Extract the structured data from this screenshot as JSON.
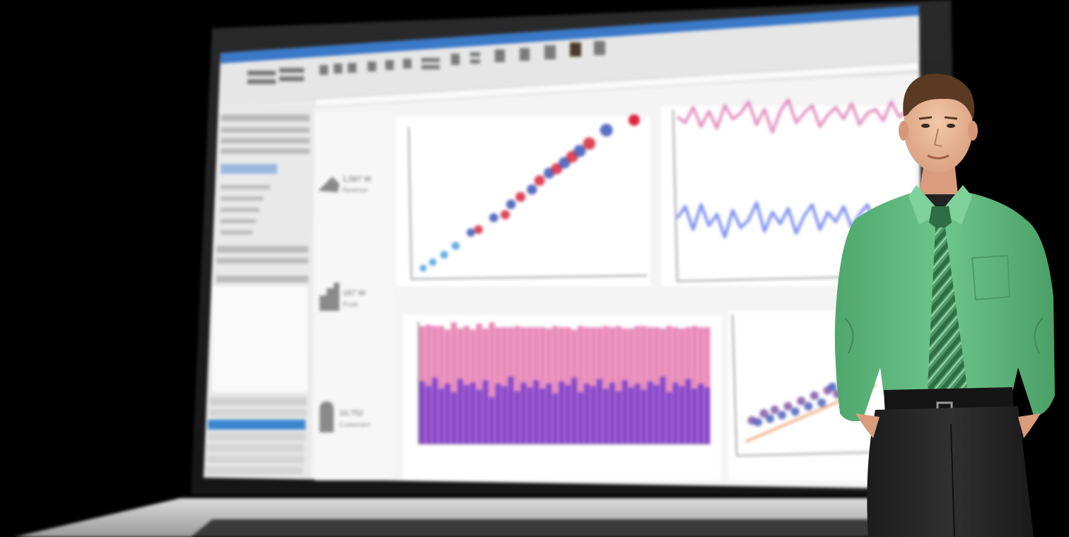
{
  "kpis": [
    {
      "value": "1,587 W",
      "label": "Revenue",
      "icon": "car-icon"
    },
    {
      "value": "167 W",
      "label": "Profit",
      "icon": "chart-icon"
    },
    {
      "value": "10,752",
      "label": "Customers",
      "icon": "android-icon"
    }
  ],
  "colors": {
    "pink_series": "#e48fbf",
    "blue_series": "#7d8ff0",
    "bar_top": "#e889b8",
    "bar_bottom": "#8a45c8",
    "scatter_red": "#d8253b",
    "scatter_blue": "#3d55b8",
    "shirt": "#66bd83",
    "tie_stripe": "#2e6e44"
  },
  "chart_data": [
    {
      "type": "scatter",
      "points": [
        [
          0.5,
          0.5
        ],
        [
          1,
          0.9
        ],
        [
          1.6,
          1.4
        ],
        [
          2.2,
          2
        ],
        [
          3,
          2.9
        ],
        [
          3.4,
          3.1
        ],
        [
          4.2,
          3.9
        ],
        [
          4.8,
          4.1
        ],
        [
          5.1,
          4.8
        ],
        [
          5.6,
          5.3
        ],
        [
          6.2,
          5.8
        ],
        [
          6.6,
          6.4
        ],
        [
          7.1,
          6.9
        ],
        [
          7.5,
          7.2
        ],
        [
          7.9,
          7.6
        ],
        [
          8.3,
          8.0
        ],
        [
          8.7,
          8.4
        ],
        [
          9.2,
          8.9
        ],
        [
          10.1,
          9.8
        ]
      ]
    },
    {
      "type": "line",
      "series": [
        {
          "values": [
            8.5,
            8.2,
            9,
            8,
            8.8,
            7.9,
            9.1,
            8.4,
            8.7,
            9.3,
            8.1,
            8.9,
            7.7,
            8.8,
            9.4,
            8.2,
            8.7,
            9.1,
            8.0,
            8.6,
            9.0,
            8.4,
            9.2,
            8.1,
            8.7,
            8.9,
            8.3,
            9.3,
            8.5,
            8.8
          ]
        },
        {
          "values": [
            3.2,
            3.8,
            2.6,
            3.9,
            2.8,
            3.4,
            2.2,
            3.6,
            2.7,
            3.1,
            4.0,
            2.5,
            3.5,
            2.9,
            3.7,
            2.4,
            3.3,
            3.9,
            2.6,
            3.5,
            3.0,
            3.8,
            2.7,
            3.4,
            3.9,
            2.8,
            3.6,
            3.2,
            3.8,
            3.4
          ]
        }
      ]
    },
    {
      "type": "bar",
      "series": [
        {
          "values": [
            5.2,
            4.8,
            5.5,
            4.6,
            5.0,
            4.3,
            5.4,
            4.9,
            5.1,
            4.5,
            5.3,
            3.9,
            5.0,
            4.8,
            5.6,
            4.4,
            5.1,
            4.7,
            5.3,
            4.6,
            5.0,
            4.2,
            5.2,
            4.9,
            5.5,
            4.3,
            5.0,
            4.8,
            5.4,
            4.6,
            5.1,
            4.4,
            5.3,
            4.7,
            5.0,
            4.5,
            5.2,
            4.9,
            5.6,
            4.3,
            5.1,
            4.8,
            5.4,
            4.6,
            5.0,
            4.7
          ]
        },
        {
          "values": [
            4.6,
            5.1,
            4.3,
            5.2,
            4.5,
            5.8,
            4.2,
            4.9,
            4.4,
            5.5,
            4.3,
            6.2,
            4.7,
            4.9,
            4.1,
            5.4,
            4.6,
            5.0,
            4.4,
            5.1,
            4.6,
            5.6,
            4.5,
            4.8,
            4.0,
            5.5,
            4.7,
            4.9,
            4.3,
            5.2,
            4.6,
            5.4,
            4.3,
            4.9,
            4.8,
            5.3,
            4.5,
            4.8,
            4.0,
            5.5,
            4.6,
            4.8,
            4.3,
            5.2,
            4.7,
            5.0
          ]
        }
      ]
    },
    {
      "type": "scatter",
      "points": [
        [
          0.5,
          1.2
        ],
        [
          1,
          1.1
        ],
        [
          1.5,
          1.6
        ],
        [
          2,
          1.3
        ],
        [
          2.4,
          1.8
        ],
        [
          3,
          1.5
        ],
        [
          3.5,
          2.0
        ],
        [
          4.1,
          1.7
        ],
        [
          4.6,
          2.3
        ],
        [
          5.2,
          2.0
        ],
        [
          5.7,
          2.6
        ],
        [
          6.3,
          2.2
        ],
        [
          6.8,
          2.9
        ],
        [
          7.2,
          3.1
        ],
        [
          7.6,
          2.7
        ],
        [
          8.0,
          3.4
        ]
      ]
    }
  ]
}
